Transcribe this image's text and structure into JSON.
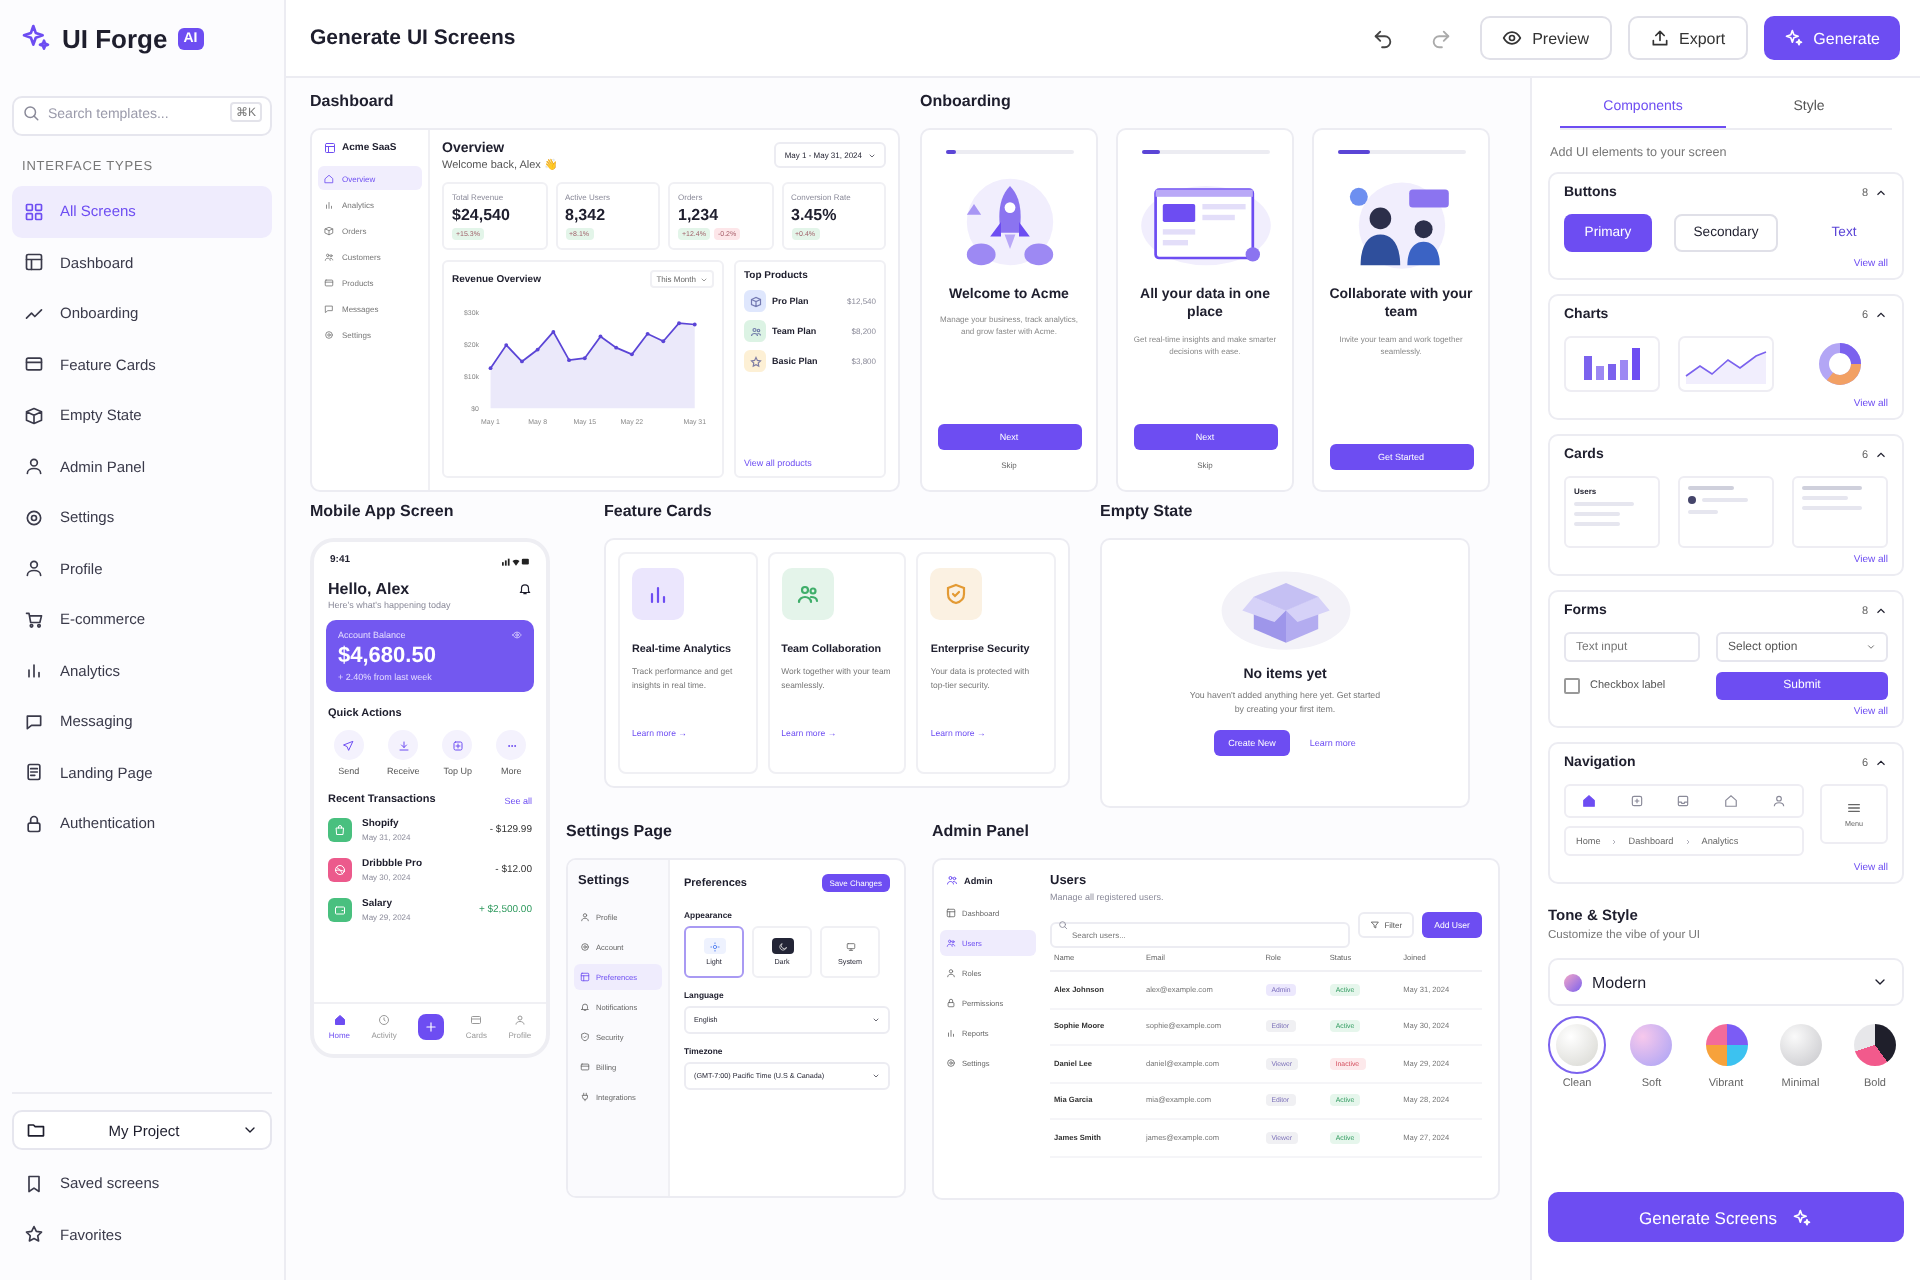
{
  "app": {
    "name": "UI Forge",
    "badge": "AI"
  },
  "header": {
    "title": "Generate UI Screens",
    "buttons": [
      {
        "label": "Preview",
        "kind": "preview"
      },
      {
        "label": "Export",
        "kind": "export"
      },
      {
        "label": "Generate",
        "kind": "generate"
      }
    ]
  },
  "sidebar": {
    "search_placeholder": "Search templates...",
    "shortcut": "⌘K",
    "section_title": "INTERFACE TYPES",
    "items": [
      {
        "label": "All Screens",
        "selected": true
      },
      {
        "label": "Dashboard",
        "selected": false
      },
      {
        "label": "Onboarding",
        "selected": false
      },
      {
        "label": "Feature Cards",
        "selected": false
      },
      {
        "label": "Empty State",
        "selected": false
      },
      {
        "label": "Admin Panel",
        "selected": false
      },
      {
        "label": "Settings",
        "selected": false
      },
      {
        "label": "Profile",
        "selected": false
      },
      {
        "label": "E-commerce",
        "selected": false
      },
      {
        "label": "Analytics",
        "selected": false
      },
      {
        "label": "Messaging",
        "selected": false
      },
      {
        "label": "Landing Page",
        "selected": false
      },
      {
        "label": "Authentication",
        "selected": false
      }
    ],
    "project": "My Project",
    "footer_items": [
      "Saved screens",
      "Favorites"
    ]
  },
  "dashboard": {
    "title": "Dashboard",
    "brand": "Acme SaaS",
    "nav": [
      {
        "label": "Overview",
        "selected": true
      },
      {
        "label": "Analytics",
        "selected": false
      },
      {
        "label": "Orders",
        "selected": false
      },
      {
        "label": "Customers",
        "selected": false
      },
      {
        "label": "Products",
        "selected": false
      },
      {
        "label": "Messages",
        "selected": false
      },
      {
        "label": "Settings",
        "selected": false
      }
    ],
    "heading": "Overview",
    "welcome": "Welcome back, Alex 👋",
    "date_range": "May 1 - May 31, 2024",
    "stats": [
      {
        "label": "Total Revenue",
        "value": "$24,540",
        "changes": [
          {
            "text": "+15.3%",
            "color": "#e3f5e9"
          }
        ]
      },
      {
        "label": "Active Users",
        "value": "8,342",
        "changes": [
          {
            "text": "+8.1%",
            "color": "#e3f5e9"
          }
        ]
      },
      {
        "label": "Orders",
        "value": "1,234",
        "changes": [
          {
            "text": "+12.4%",
            "color": "#e3f5e9"
          },
          {
            "text": "-0.2%",
            "color": "#fde6e9"
          }
        ]
      },
      {
        "label": "Conversion Rate",
        "value": "3.45%",
        "changes": [
          {
            "text": "+0.4%",
            "color": "#e3f5e9"
          }
        ]
      }
    ],
    "revenue": {
      "title": "Revenue Overview",
      "period": "This Month",
      "chart_data": {
        "type": "area",
        "categories": [
          "May 1",
          null,
          null,
          "May 8",
          null,
          null,
          "May 15",
          null,
          null,
          "May 22",
          null,
          null,
          null,
          "May 31"
        ],
        "ylim": [
          0,
          30000
        ],
        "yticks": [
          {
            "value": 0,
            "label": "$0"
          },
          {
            "value": 10000,
            "label": "$10k"
          },
          {
            "value": 20000,
            "label": "$20k"
          },
          {
            "value": 30000,
            "label": "$30k"
          }
        ],
        "series": [
          {
            "color": "#5b45d6",
            "values": [
              12500,
              19700,
              14600,
              18300,
              23800,
              15000,
              15600,
              22400,
              18900,
              16800,
              23200,
              20900,
              26500,
              26100
            ]
          }
        ]
      }
    },
    "top_products": {
      "title": "Top Products",
      "items": [
        {
          "name": "Pro Plan",
          "value": "$12,540",
          "color": "#dfe7fd"
        },
        {
          "name": "Team Plan",
          "value": "$8,200",
          "color": "#dcf3e4"
        },
        {
          "name": "Basic Plan",
          "value": "$3,800",
          "color": "#fdf0d5"
        }
      ],
      "link": "View all products"
    }
  },
  "onboarding": {
    "title": "Onboarding",
    "cards": [
      {
        "kind": "rocket",
        "level": 0.08,
        "title": "Welcome to Acme",
        "body": "Manage your business, track analytics, and grow faster with Acme.",
        "button": "Next",
        "link": "Skip"
      },
      {
        "kind": "dashboard",
        "level": 0.15,
        "title": "All your data in one place",
        "body": "Get real-time insights and make smarter decisions with ease.",
        "button": "Next",
        "link": "Skip"
      },
      {
        "kind": "team",
        "level": 0.25,
        "title": "Collaborate with your team",
        "body": "Invite your team and work together seamlessly.",
        "button": "Get Started"
      }
    ]
  },
  "mobile": {
    "title": "Mobile App Screen",
    "time": "9:41",
    "greeting": "Hello, Alex",
    "subtitle": "Here's what's happening today",
    "balance_label": "Account Balance",
    "balance": "$4,680.50",
    "balance_change": "+ 2.40% from last week",
    "actions_title": "Quick Actions",
    "actions": [
      "Send",
      "Receive",
      "Top Up",
      "More"
    ],
    "transactions_title": "Recent Transactions",
    "see_all": "See all",
    "transactions": [
      {
        "name": "Shopify",
        "date": "May 31, 2024",
        "amount": "- $129.99",
        "kind": "debit",
        "color": "#49c07f"
      },
      {
        "name": "Dribbble Pro",
        "date": "May 30, 2024",
        "amount": "- $12.00",
        "kind": "debit",
        "color": "#ec5a8c"
      },
      {
        "name": "Salary",
        "date": "May 29, 2024",
        "amount": "+ $2,500.00",
        "kind": "credit",
        "color": "#49c07f"
      }
    ],
    "tabs": [
      {
        "kind": "tab",
        "label": "Home",
        "selected": true
      },
      {
        "kind": "tab",
        "label": "Activity",
        "selected": false
      },
      {
        "kind": "add"
      },
      {
        "kind": "tab",
        "label": "Cards",
        "selected": false
      },
      {
        "kind": "tab",
        "label": "Profile",
        "selected": false
      }
    ]
  },
  "feature_cards": {
    "title": "Feature Cards",
    "cards": [
      {
        "title": "Real-time Analytics",
        "body": "Track performance and get insights in real time.",
        "link": "Learn more →",
        "color": "#6d4df2"
      },
      {
        "title": "Team Collaboration",
        "body": "Work together with your team seamlessly.",
        "link": "Learn more →",
        "color": "#3fae6a"
      },
      {
        "title": "Enterprise Security",
        "body": "Your data is protected with top-tier security.",
        "link": "Learn more →",
        "color": "#e39a33"
      }
    ]
  },
  "empty_state": {
    "title": "Empty State",
    "heading": "No items yet",
    "body": "You haven't added anything here yet. Get started by creating your first item.",
    "button": "Create New",
    "link": "Learn more"
  },
  "settings_page": {
    "title": "Settings Page",
    "side_title": "Settings",
    "nav": [
      {
        "label": "Profile",
        "selected": false
      },
      {
        "label": "Account",
        "selected": false
      },
      {
        "label": "Preferences",
        "selected": true
      },
      {
        "label": "Notifications",
        "selected": false
      },
      {
        "label": "Security",
        "selected": false
      },
      {
        "label": "Billing",
        "selected": false
      },
      {
        "label": "Integrations",
        "selected": false
      }
    ],
    "heading": "Preferences",
    "save": "Save Changes",
    "appearance": "Appearance",
    "themes": [
      {
        "label": "Light",
        "kind": "light",
        "selected": true
      },
      {
        "label": "Dark",
        "kind": "dark",
        "selected": false
      },
      {
        "label": "System",
        "kind": "system",
        "selected": false
      }
    ],
    "language_label": "Language",
    "language": "English",
    "timezone_label": "Timezone",
    "timezone": "(GMT-7:00) Pacific Time (U.S & Canada)"
  },
  "admin_panel": {
    "title": "Admin Panel",
    "brand": "Admin",
    "nav": [
      {
        "label": "Dashboard",
        "selected": false
      },
      {
        "label": "Users",
        "selected": true
      },
      {
        "label": "Roles",
        "selected": false
      },
      {
        "label": "Permissions",
        "selected": false
      },
      {
        "label": "Reports",
        "selected": false
      },
      {
        "label": "Settings",
        "selected": false
      }
    ],
    "heading": "Users",
    "subtitle": "Manage all registered users.",
    "search_placeholder": "Search users...",
    "filter": "Filter",
    "add": "Add User",
    "columns": [
      "Name",
      "Email",
      "Role",
      "Status",
      "Joined"
    ],
    "rows": [
      {
        "name": "Alex Johnson",
        "email": "alex@example.com",
        "role": {
          "text": "Admin",
          "color": "#ece8fd"
        },
        "status": {
          "text": "Active",
          "active": true
        },
        "joined": "May 31, 2024"
      },
      {
        "name": "Sophie Moore",
        "email": "sophie@example.com",
        "role": {
          "text": "Editor",
          "color": "#f0f0f3"
        },
        "status": {
          "text": "Active",
          "active": true
        },
        "joined": "May 30, 2024"
      },
      {
        "name": "Daniel Lee",
        "email": "daniel@example.com",
        "role": {
          "text": "Viewer",
          "color": "#f0f0f3"
        },
        "status": {
          "text": "Inactive",
          "active": false
        },
        "joined": "May 29, 2024"
      },
      {
        "name": "Mia Garcia",
        "email": "mia@example.com",
        "role": {
          "text": "Editor",
          "color": "#f0f0f3"
        },
        "status": {
          "text": "Active",
          "active": true
        },
        "joined": "May 28, 2024"
      },
      {
        "name": "James Smith",
        "email": "james@example.com",
        "role": {
          "text": "Viewer",
          "color": "#f0f0f3"
        },
        "status": {
          "text": "Active",
          "active": true
        },
        "joined": "May 27, 2024"
      }
    ]
  },
  "panel": {
    "tabs": [
      {
        "label": "Components",
        "selected": true
      },
      {
        "label": "Style",
        "selected": false
      }
    ],
    "hint": "Add UI elements to your screen",
    "sections": [
      {
        "kind": "buttons",
        "title": "Buttons",
        "count": "8",
        "expanded": true,
        "view_all": "View all",
        "samples": [
          {
            "label": "Primary",
            "kind": "primary"
          },
          {
            "label": "Secondary",
            "kind": "secondary"
          },
          {
            "label": "Text",
            "kind": "text"
          }
        ]
      },
      {
        "kind": "charts",
        "title": "Charts",
        "count": "6",
        "expanded": true,
        "view_all": "View all",
        "previews": [
          {
            "kind": "bar"
          },
          {
            "kind": "line"
          },
          {
            "kind": "donut"
          }
        ]
      },
      {
        "kind": "cards",
        "title": "Cards",
        "count": "6",
        "expanded": true,
        "view_all": "View all",
        "previews": [
          {
            "kind": "list",
            "title": "Users"
          },
          {
            "kind": "profile"
          },
          {
            "kind": "text"
          }
        ]
      },
      {
        "kind": "forms",
        "title": "Forms",
        "count": "8",
        "expanded": true,
        "view_all": "View all",
        "input_placeholder": "Text input",
        "select": "Select option",
        "checkbox": {
          "label": "Checkbox label",
          "checked": false
        },
        "submit": "Submit"
      },
      {
        "kind": "navigation",
        "title": "Navigation",
        "count": "6",
        "expanded": true,
        "view_all": "View all",
        "tabs": [
          {
            "selected": true
          },
          {
            "selected": false
          },
          {
            "selected": false
          },
          {
            "selected": false
          },
          {
            "selected": false
          }
        ],
        "breadcrumbs": [
          "Home",
          "Dashboard",
          "Analytics"
        ],
        "menu_label": "Menu"
      }
    ],
    "tone": {
      "title": "Tone & Style",
      "subtitle": "Customize the vibe of your UI",
      "value": "Modern",
      "swatches": [
        {
          "label": "Clean",
          "kind": "clean",
          "selected": true
        },
        {
          "label": "Soft",
          "kind": "soft",
          "selected": false
        },
        {
          "label": "Vibrant",
          "kind": "vibrant",
          "selected": false
        },
        {
          "label": "Minimal",
          "kind": "minimal",
          "selected": false
        },
        {
          "label": "Bold",
          "kind": "bold",
          "selected": false
        }
      ]
    },
    "generate": "Generate Screens"
  }
}
